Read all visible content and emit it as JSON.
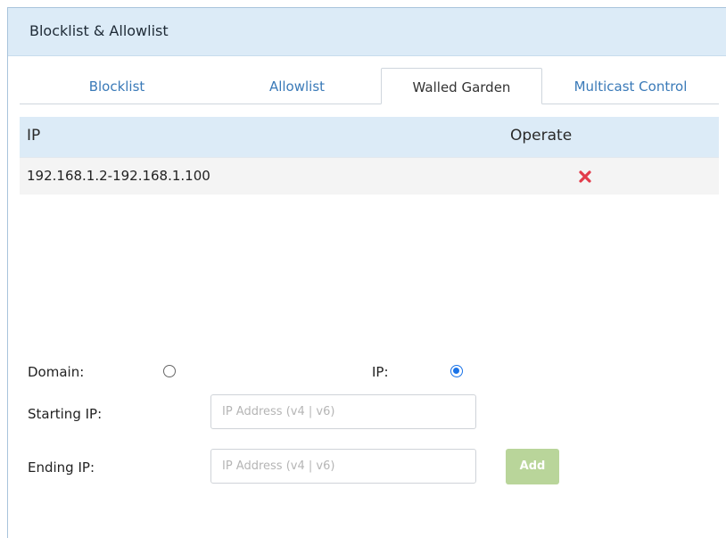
{
  "panel": {
    "title": "Blocklist & Allowlist"
  },
  "tabs": [
    {
      "label": "Blocklist",
      "active": false
    },
    {
      "label": "Allowlist",
      "active": false
    },
    {
      "label": "Walled Garden",
      "active": true
    },
    {
      "label": "Multicast Control",
      "active": false
    }
  ],
  "table": {
    "headers": {
      "ip": "IP",
      "operate": "Operate"
    },
    "rows": [
      {
        "ip": "192.168.1.2-192.168.1.100",
        "operate_icon": "delete-icon"
      }
    ]
  },
  "form": {
    "domain_label": "Domain:",
    "ip_label": "IP:",
    "selected_type": "IP",
    "starting_ip_label": "Starting IP:",
    "starting_ip_placeholder": "IP Address (v4 | v6)",
    "starting_ip_value": "",
    "ending_ip_label": "Ending IP:",
    "ending_ip_placeholder": "IP Address (v4 | v6)",
    "ending_ip_value": "",
    "add_label": "Add"
  },
  "colors": {
    "header_bg": "#dcebf7",
    "tab_link": "#3a7ab8",
    "delete_red": "#e23b4a",
    "radio_checked": "#1a73e8",
    "add_button": "#b9d59a"
  }
}
